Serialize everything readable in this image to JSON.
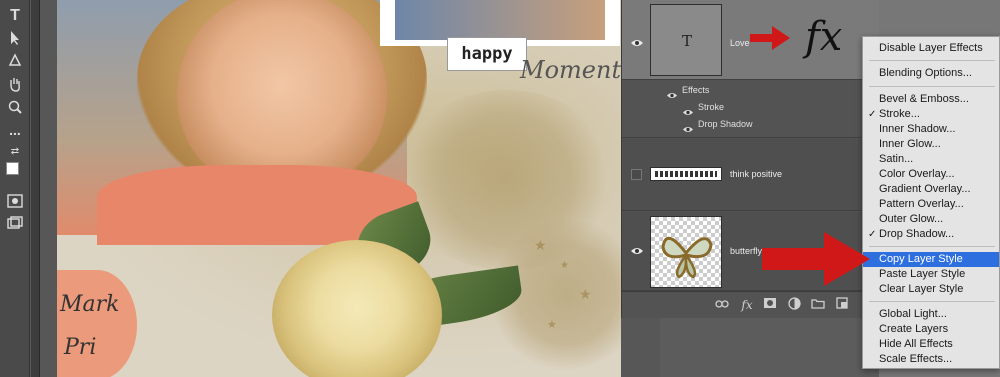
{
  "canvas": {
    "happy_tag": "happy",
    "moment_text": "Moment",
    "heart_line1": "Mark",
    "heart_line2": "Pri"
  },
  "layers_panel": {
    "layers": [
      {
        "name": "Love",
        "thumb_glyph": "T",
        "visible": true,
        "selected": true
      },
      {
        "name": "think positive",
        "visible": false,
        "selected": false
      },
      {
        "name": "butterfly",
        "visible": true,
        "selected": false
      }
    ],
    "effects_label": "Effects",
    "effects": [
      "Stroke",
      "Drop Shadow"
    ],
    "fx_label": "fx",
    "footer_icons": [
      "link-icon",
      "fx-icon",
      "mask-icon",
      "adjustment-icon",
      "folder-icon",
      "new-layer-icon"
    ]
  },
  "context_menu": {
    "items": [
      {
        "label": "Disable Layer Effects",
        "checked": false
      },
      {
        "label": "Blending Options...",
        "checked": false
      },
      {
        "label": "Bevel & Emboss...",
        "checked": false
      },
      {
        "label": "Stroke...",
        "checked": true
      },
      {
        "label": "Inner Shadow...",
        "checked": false
      },
      {
        "label": "Inner Glow...",
        "checked": false
      },
      {
        "label": "Satin...",
        "checked": false
      },
      {
        "label": "Color Overlay...",
        "checked": false
      },
      {
        "label": "Gradient Overlay...",
        "checked": false
      },
      {
        "label": "Pattern Overlay...",
        "checked": false
      },
      {
        "label": "Outer Glow...",
        "checked": false
      },
      {
        "label": "Drop Shadow...",
        "checked": true
      },
      {
        "label": "Copy Layer Style",
        "checked": false,
        "highlighted": true
      },
      {
        "label": "Paste Layer Style",
        "checked": false
      },
      {
        "label": "Clear Layer Style",
        "checked": false
      },
      {
        "label": "Global Light...",
        "checked": false
      },
      {
        "label": "Create Layers",
        "checked": false
      },
      {
        "label": "Hide All Effects",
        "checked": false
      },
      {
        "label": "Scale Effects...",
        "checked": false
      }
    ],
    "highlight_color": "#2e6fe0"
  },
  "toolbar": {
    "tools": [
      "type-tool-icon",
      "path-select-icon",
      "shape-icon",
      "hand-icon",
      "zoom-icon",
      "more-icon",
      "swap-colors-icon",
      "color-swatch",
      "quick-mask-icon",
      "screen-mode-icon"
    ],
    "type_glyph": "T",
    "more_glyph": "..."
  },
  "annotation_arrow_color": "#d01818"
}
